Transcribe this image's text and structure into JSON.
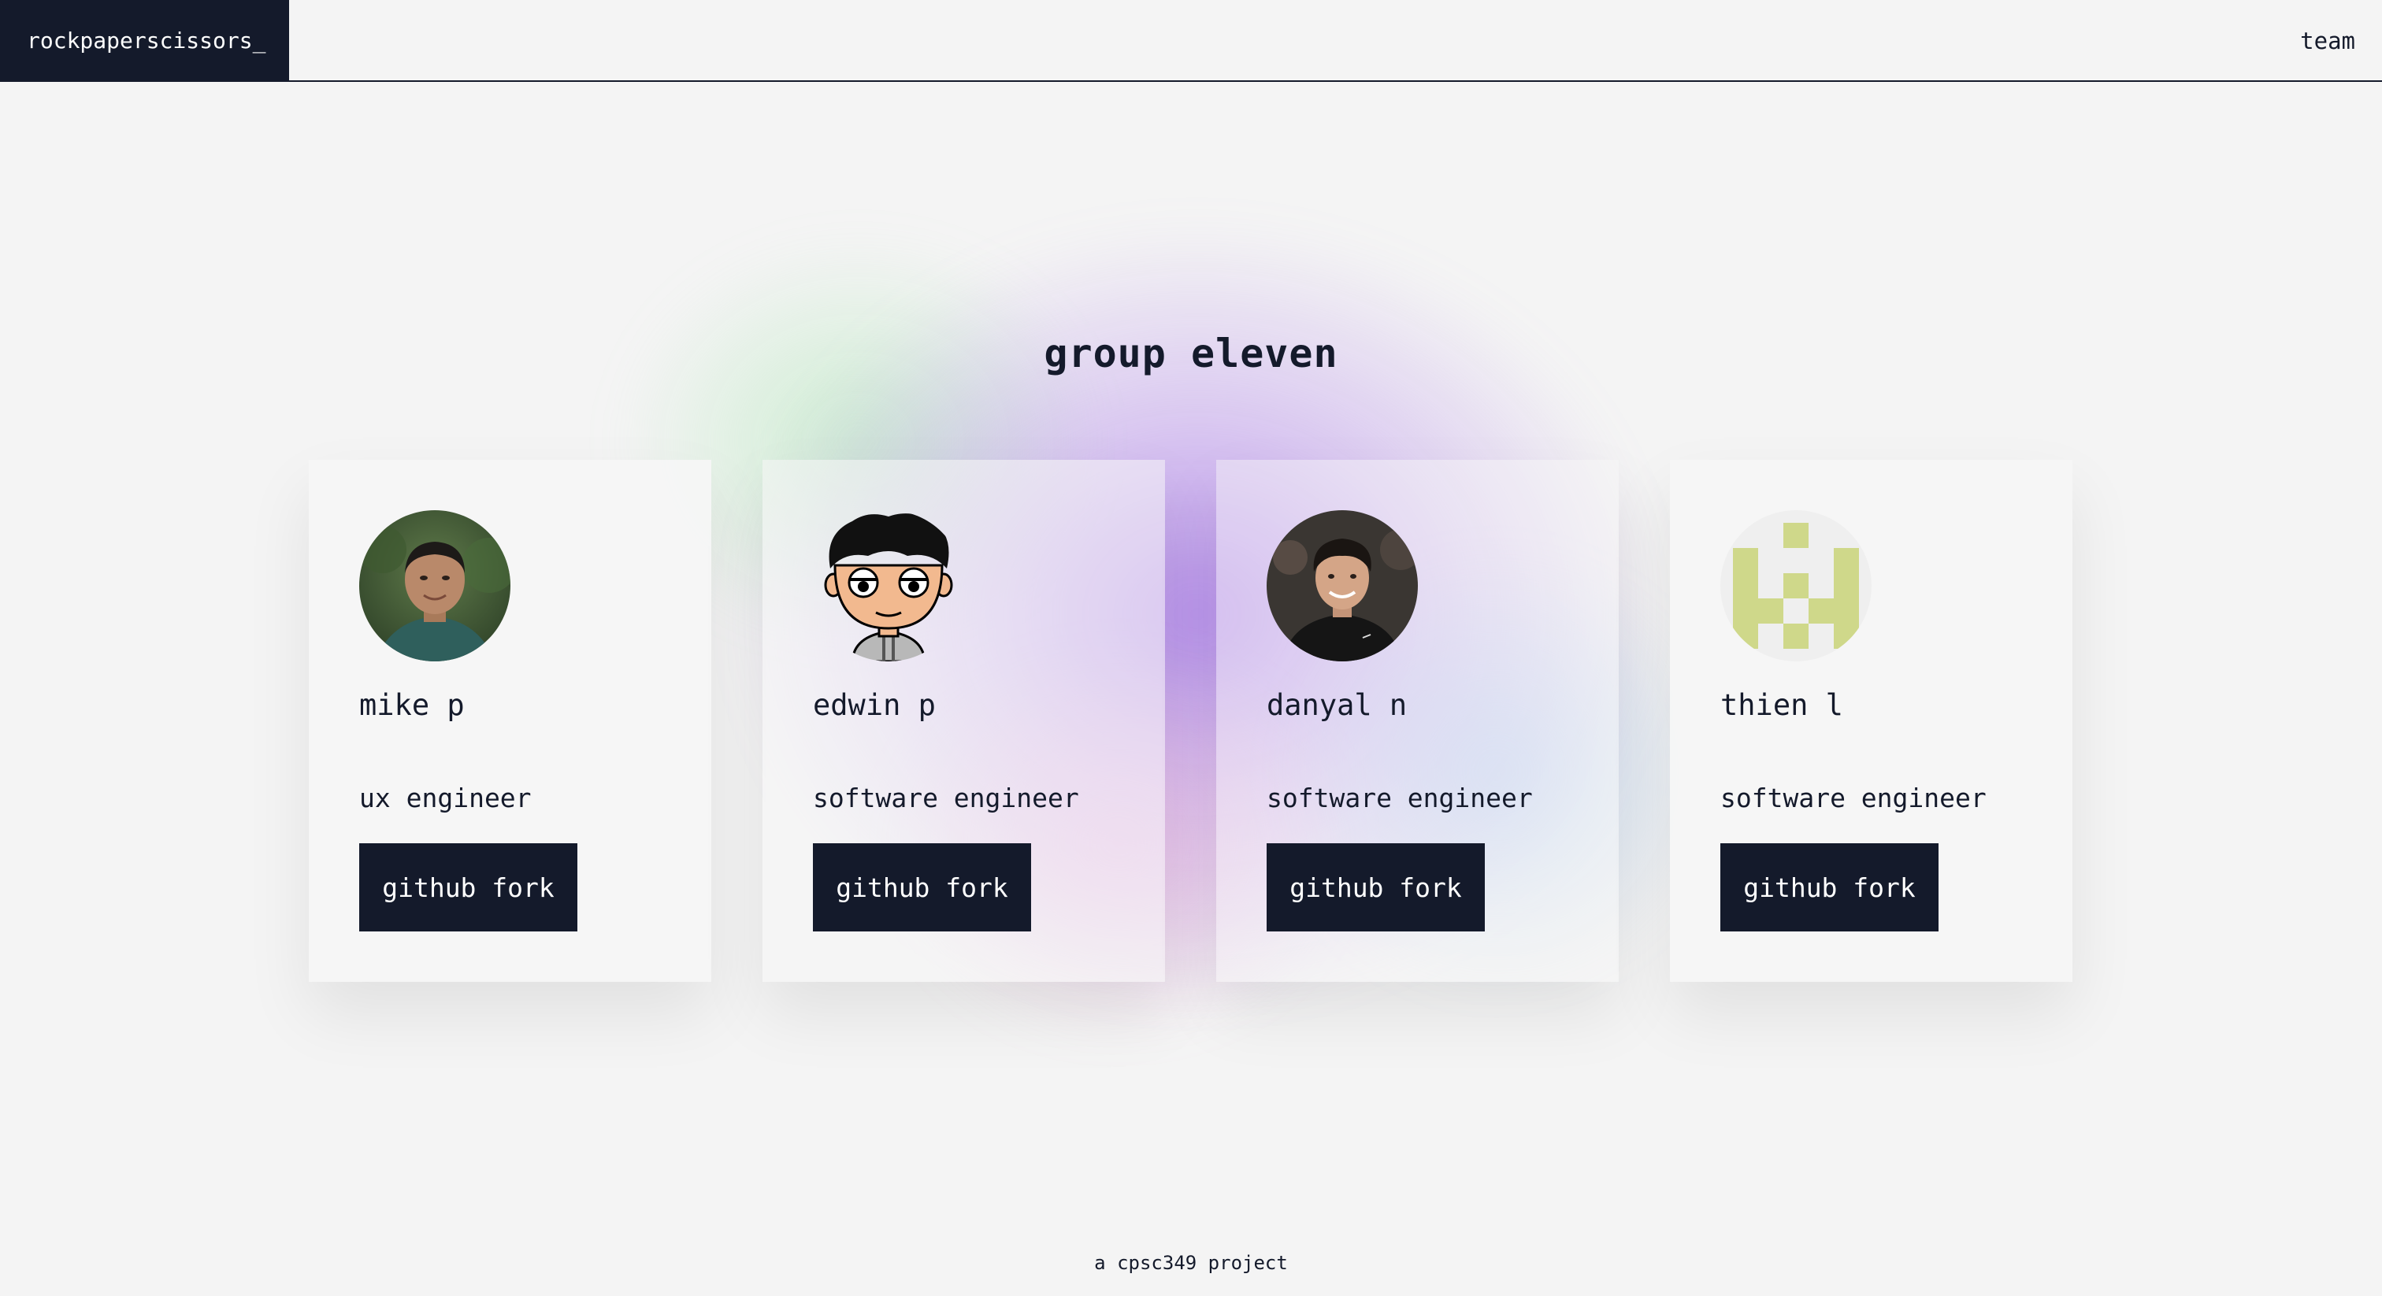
{
  "nav": {
    "brand": "rockpaperscissors_",
    "team_link": "team"
  },
  "main": {
    "heading": "group eleven",
    "members": [
      {
        "name": "mike p",
        "role": "ux engineer",
        "button": "github fork",
        "avatar_icon": "photo-avatar-icon"
      },
      {
        "name": "edwin p",
        "role": "software engineer",
        "button": "github fork",
        "avatar_icon": "cartoon-avatar-icon"
      },
      {
        "name": "danyal n",
        "role": "software engineer",
        "button": "github fork",
        "avatar_icon": "photo-avatar-icon"
      },
      {
        "name": "thien l",
        "role": "software engineer",
        "button": "github fork",
        "avatar_icon": "identicon-avatar-icon"
      }
    ]
  },
  "footer": {
    "text": "a cpsc349 project"
  },
  "colors": {
    "dark": "#141a2b",
    "background": "#f4f4f4",
    "identicon": "#cfd88a"
  }
}
